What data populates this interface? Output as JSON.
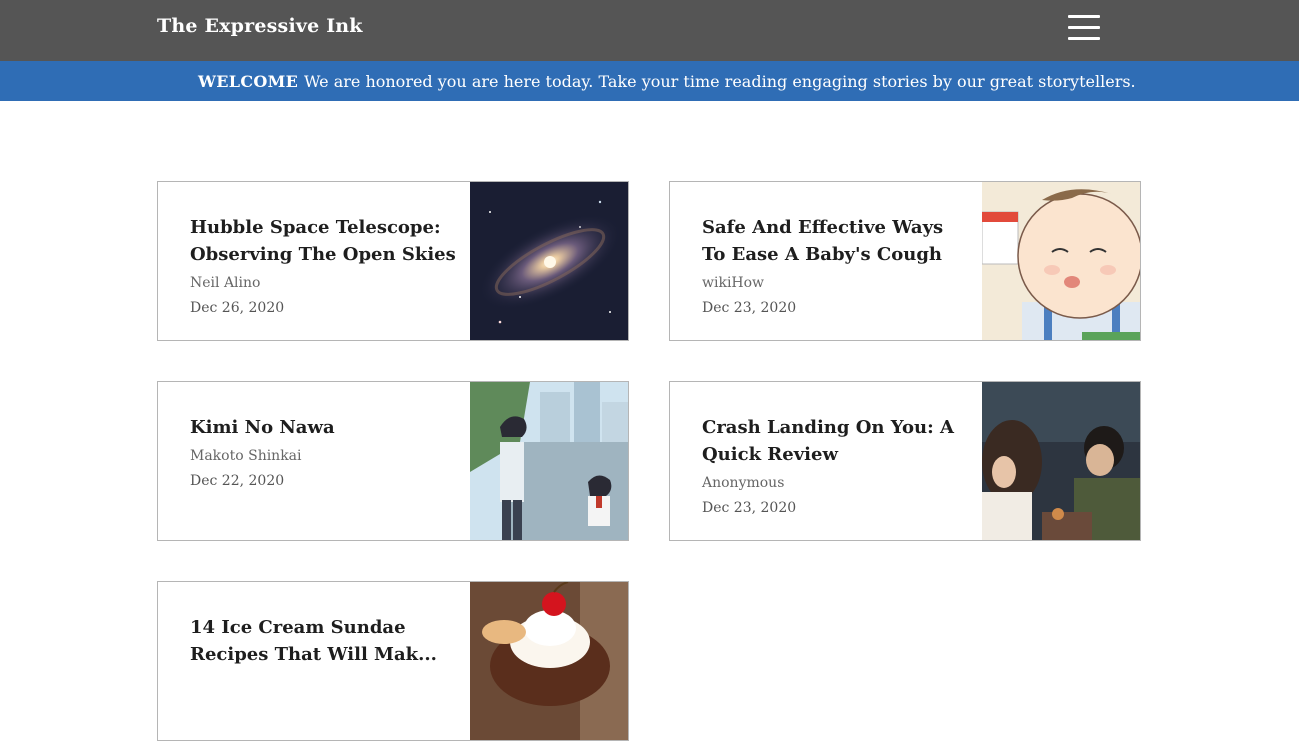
{
  "header": {
    "brand": "The Expressive Ink",
    "menu_icon": "hamburger-menu-icon"
  },
  "banner": {
    "label": "WELCOME",
    "message": "We are honored you are here today. Take your time reading engaging stories by our great storytellers."
  },
  "articles": [
    {
      "title": "Hubble Space Telescope: Observing The Open Skies",
      "author": "Neil Alino",
      "date": "Dec 26, 2020",
      "image": "galaxy-image"
    },
    {
      "title": "Safe And Effective Ways To Ease A Baby's Cough At...",
      "author": "wikiHow",
      "date": "Dec 23, 2020",
      "image": "baby-illustration-image"
    },
    {
      "title": "Kimi No Nawa",
      "author": "Makoto Shinkai",
      "date": "Dec 22, 2020",
      "image": "anime-scene-image"
    },
    {
      "title": "Crash Landing On You: A Quick Review",
      "author": "Anonymous",
      "date": "Dec 23, 2020",
      "image": "drama-scene-image"
    },
    {
      "title": "14 Ice Cream Sundae Recipes That Will Mak...",
      "author": "",
      "date": "",
      "image": "ice-cream-sundae-image"
    }
  ],
  "colors": {
    "topbar": "#555555",
    "banner": "#2f6db5"
  }
}
